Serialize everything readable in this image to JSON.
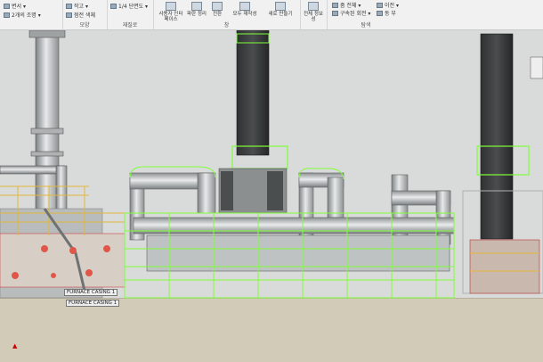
{
  "ribbon": {
    "groups": [
      {
        "label": "",
        "items": [
          "변서 ▾",
          "2개의 조명 ▾"
        ]
      },
      {
        "label": "모양",
        "items": [
          "작고 ▾",
          "점전 색체"
        ]
      },
      {
        "label": "재질로",
        "items": [
          "1/4 단면도 ▾"
        ]
      },
      {
        "label": "창",
        "items": [
          "사용자 인터페이스",
          "파란 정리",
          "전환",
          "모두 재작성",
          "새로 만들기"
        ]
      },
      {
        "label": "",
        "items": [
          "전체 정보 성"
        ]
      },
      {
        "label": "탐색",
        "items": [
          "줌 전체 ▾",
          "구속된 회전 ▾",
          "이전 ▾",
          "동 부"
        ]
      }
    ]
  },
  "viewport": {
    "tags": [
      "FURNACE CASING 1",
      "FURNACE CASING 1"
    ],
    "highlight_color": "#7fff3a",
    "axis_icon": "xyz-axis-icon"
  }
}
